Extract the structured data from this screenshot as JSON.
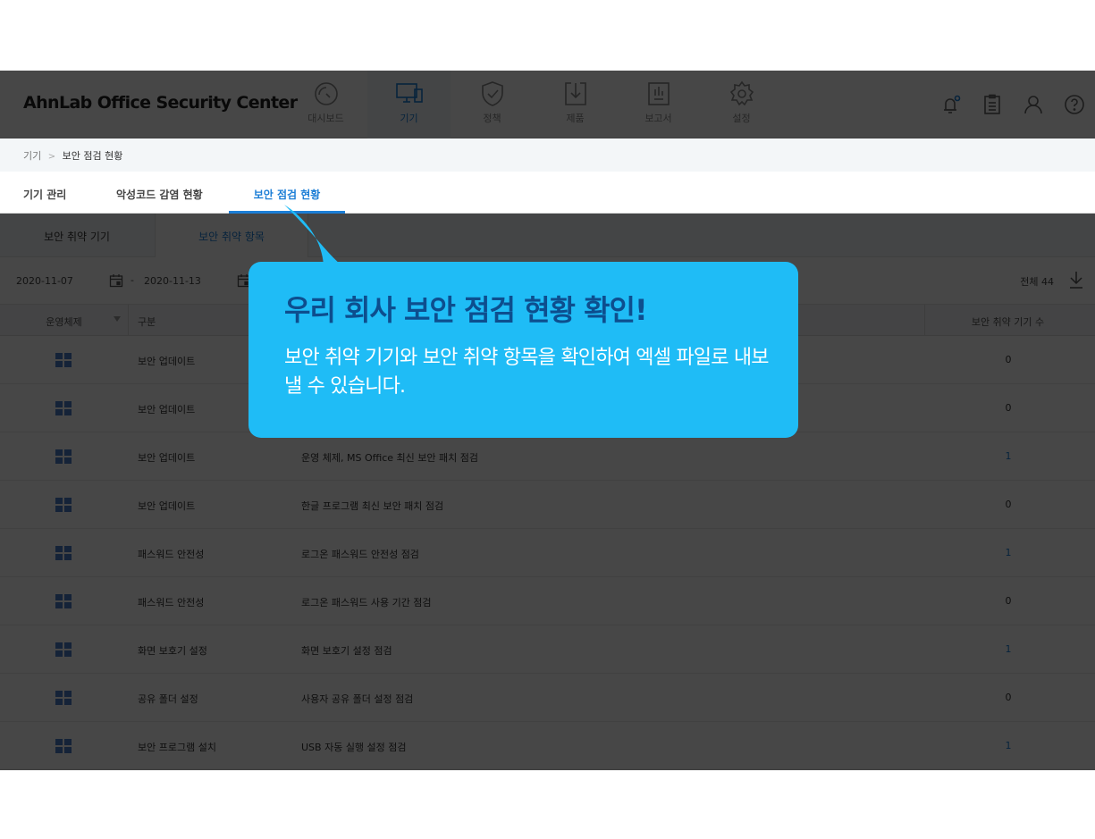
{
  "app": {
    "logo": "AhnLab Office Security Center"
  },
  "nav": [
    {
      "label": "대시보드",
      "icon": "dashboard-gauge-icon",
      "active": false
    },
    {
      "label": "기기",
      "icon": "devices-icon",
      "active": true
    },
    {
      "label": "정책",
      "icon": "shield-check-icon",
      "active": false
    },
    {
      "label": "제품",
      "icon": "download-box-icon",
      "active": false
    },
    {
      "label": "보고서",
      "icon": "report-chart-icon",
      "active": false
    },
    {
      "label": "설정",
      "icon": "gear-icon",
      "active": false
    }
  ],
  "top_icons": [
    "bell-icon",
    "clipboard-icon",
    "user-icon",
    "help-icon"
  ],
  "breadcrumb": {
    "parent": "기기",
    "separator": ">",
    "current": "보안 점검 현황"
  },
  "tabs": [
    {
      "label": "기기 관리",
      "active": false
    },
    {
      "label": "악성코드 감염 현황",
      "active": false
    },
    {
      "label": "보안 점검 현황",
      "active": true
    }
  ],
  "subtabs": [
    {
      "label": "보안 취약 기기",
      "active": false
    },
    {
      "label": "보안 취약 항목",
      "active": true
    }
  ],
  "filter": {
    "date_from": "2020-11-07",
    "date_sep": "-",
    "date_to": "2020-11-13",
    "total_label": "전체 44"
  },
  "table": {
    "headers": {
      "os": "운영체제",
      "category": "구분",
      "count": "보안 취약 기기 수"
    },
    "rows": [
      {
        "os": "windows",
        "category": "보안 업데이트",
        "item": "",
        "count": "0"
      },
      {
        "os": "windows",
        "category": "보안 업데이트",
        "item": "",
        "count": "0"
      },
      {
        "os": "windows",
        "category": "보안 업데이트",
        "item": "운영 체제, MS Office 최신 보안 패치 점검",
        "count": "1"
      },
      {
        "os": "windows",
        "category": "보안 업데이트",
        "item": "한글 프로그램 최신 보안 패치 점검",
        "count": "0"
      },
      {
        "os": "windows",
        "category": "패스워드 안전성",
        "item": "로그온 패스워드 안전성 점검",
        "count": "1"
      },
      {
        "os": "windows",
        "category": "패스워드 안전성",
        "item": "로그온 패스워드 사용 기간 점검",
        "count": "0"
      },
      {
        "os": "windows",
        "category": "화면 보호기 설정",
        "item": "화면 보호기 설정 점검",
        "count": "1"
      },
      {
        "os": "windows",
        "category": "공유 폴더 설정",
        "item": "사용자 공유 폴더 설정 점검",
        "count": "0"
      },
      {
        "os": "windows",
        "category": "보안 프로그램 설치",
        "item": "USB 자동 실행 설정 점검",
        "count": "1"
      }
    ]
  },
  "callout": {
    "title": "우리 회사 보안 점검 현황 확인!",
    "description": "보안 취약 기기와 보안 취약 항목을 확인하여 엑셀 파일로 내보낼 수 있습니다."
  },
  "colors": {
    "accent": "#1c7ed6",
    "callout_bg": "#1fbcf6",
    "callout_title": "#0d4e8e",
    "dim": "rgba(0,0,0,0.72)"
  }
}
